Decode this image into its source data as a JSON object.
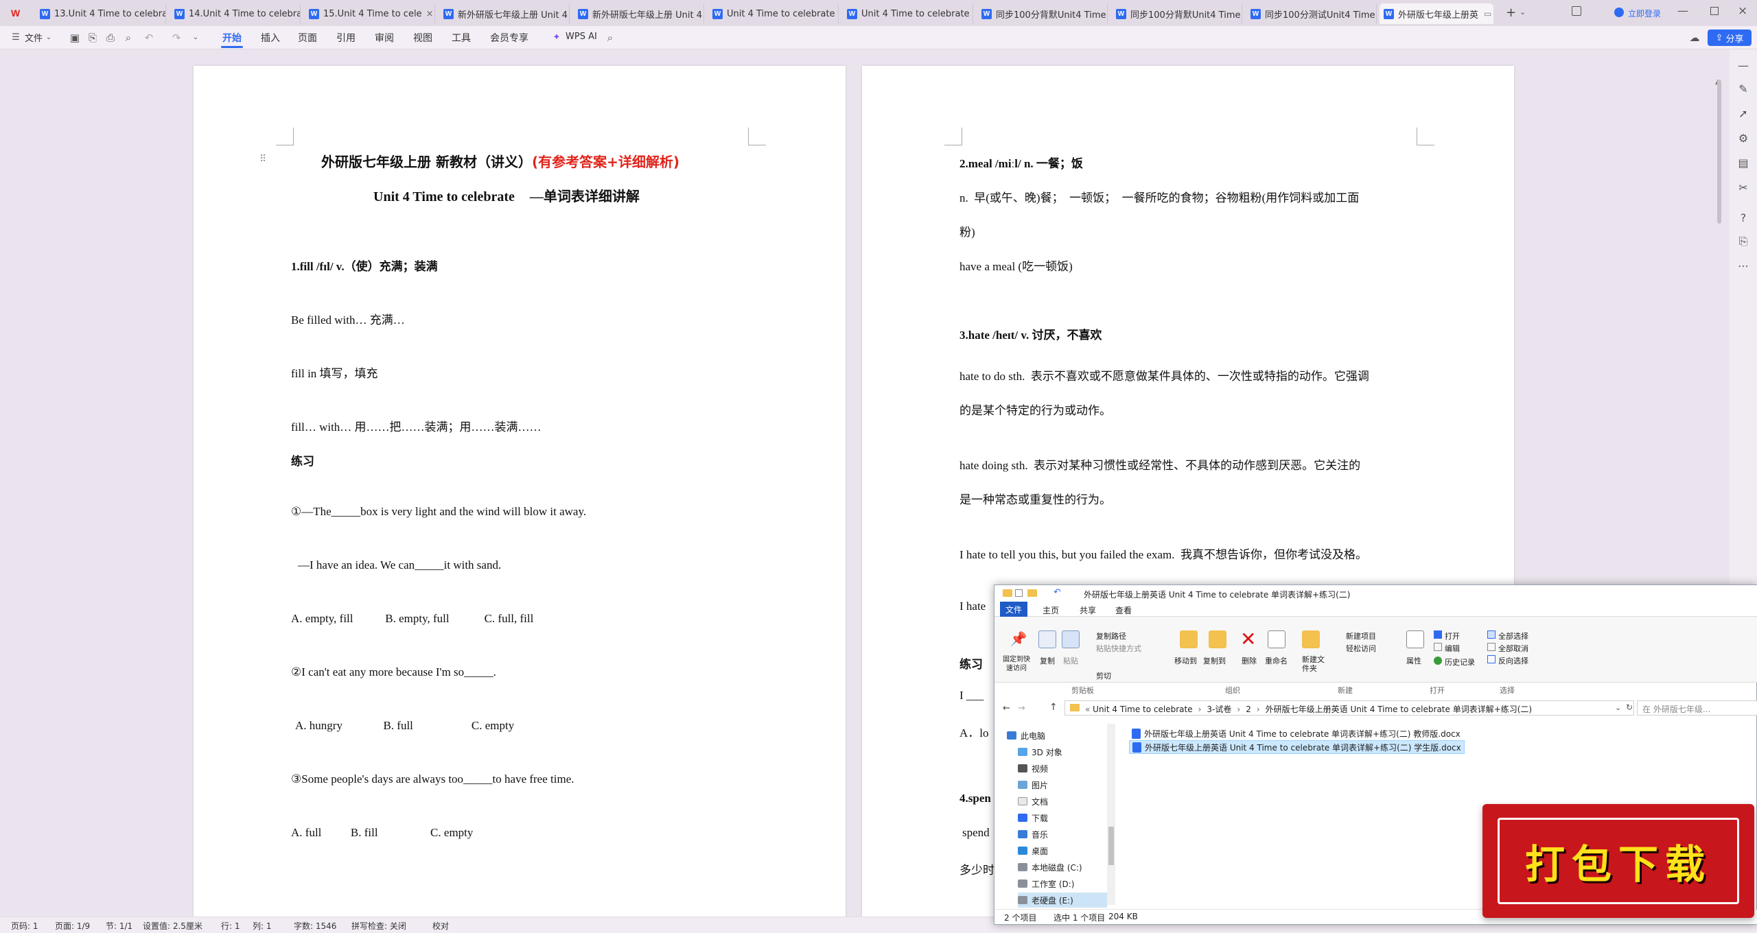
{
  "tabs": [
    {
      "label": "13.Unit 4 Time to celebrat"
    },
    {
      "label": "14.Unit 4 Time to celebrat"
    },
    {
      "label": "15.Unit 4 Time to cele"
    },
    {
      "label": "新外研版七年级上册 Unit 4"
    },
    {
      "label": "新外研版七年级上册 Unit 4"
    },
    {
      "label": "Unit 4 Time to celebrate"
    },
    {
      "label": "Unit 4 Time to celebrate"
    },
    {
      "label": "同步100分背默Unit4 Time"
    },
    {
      "label": "同步100分背默Unit4 Time"
    },
    {
      "label": "同步100分测试Unit4 Time"
    },
    {
      "label": "外研版七年级上册英"
    }
  ],
  "topright": {
    "login": "立即登录",
    "share": "分享"
  },
  "toolbar": {
    "file": "文件",
    "menus": [
      "开始",
      "插入",
      "页面",
      "引用",
      "审阅",
      "视图",
      "工具",
      "会员专享"
    ],
    "ai": "WPS AI"
  },
  "page1": {
    "title_black": "外研版七年级上册 新教材（讲义）",
    "title_red": "(有参考答案+详细解析)",
    "subtitle_a": "Unit 4 Time to celebrate",
    "subtitle_b": "—单词表详细讲解",
    "lines": [
      "1.fill /fɪl/ v.（使）充满；装满",
      "Be filled with… 充满…",
      "fill in 填写，填充",
      "fill… with… 用……把……装满；用……装满……",
      "练习",
      "①—The_____box is very light and the wind will blow it away.",
      "—I have an idea. We can_____it with sand.",
      "A. empty, fill           B. empty, full            C. full, fill",
      "②I can't eat any more because I'm so_____.",
      "A. hungry              B. full                    C. empty",
      "③Some people's days are always too_____to have free time.",
      "A. full          B. fill                  C. empty"
    ]
  },
  "page2": {
    "lines": [
      "2.meal /miːl/ n. 一餐；饭",
      "n.  早(或午、晚)餐；  一顿饭；  一餐所吃的食物；谷物粗粉(用作饲料或加工面",
      "粉)",
      "have a meal (吃一顿饭)",
      "3.hate /heɪt/ v. 讨厌，不喜欢",
      "hate to do sth.  表示不喜欢或不愿意做某件具体的、一次性或特指的动作。它强调",
      "的是某个特定的行为或动作。",
      "hate doing sth.  表示对某种习惯性或经常性、不具体的动作感到厌恶。它关注的",
      "是一种常态或重复性的行为。",
      "I hate to tell you this, but you failed the exam.  我真不想告诉你，但你考试没及格。",
      "I hate",
      "练习",
      "I ___",
      "A．lo",
      "4.spen",
      "spend",
      "多少时"
    ]
  },
  "statusbar": {
    "items": [
      "页码: 1",
      "页面: 1/9",
      "节: 1/1",
      "设置值: 2.5厘米",
      "行: 1",
      "列: 1",
      "字数: 1546",
      "拼写检查: 关闭",
      "校对"
    ]
  },
  "explorer": {
    "title": "外研版七年级上册英语  Unit 4 Time to celebrate 单词表详解+练习(二)",
    "ribbon_tabs": [
      "文件",
      "主页",
      "共享",
      "查看"
    ],
    "groups": {
      "clipboard": {
        "label": "剪贴板",
        "pin": "固定到快速访问",
        "copy": "复制",
        "paste": "粘贴",
        "copy_path": "复制路径",
        "paste_shortcut": "粘贴快捷方式",
        "cut": "剪切"
      },
      "organize": {
        "label": "组织",
        "move_to": "移动到",
        "copy_to": "复制到",
        "delete": "删除",
        "rename": "重命名"
      },
      "new": {
        "label": "新建",
        "new_item": "新建项目",
        "easy_access": "轻松访问",
        "new_folder": "新建文件夹"
      },
      "open": {
        "label": "打开",
        "properties": "属性",
        "open": "打开",
        "edit": "编辑",
        "history": "历史记录"
      },
      "select": {
        "label": "选择",
        "select_all": "全部选择",
        "select_none": "全部取消",
        "invert": "反向选择"
      }
    },
    "breadcrumb": [
      "Unit 4 Time to celebrate",
      "3-试卷",
      "2",
      "外研版七年级上册英语  Unit 4 Time to celebrate 单词表详解+练习(二)"
    ],
    "search_placeholder": "在 外研版七年级...",
    "nav": [
      "此电脑",
      "3D 对象",
      "视频",
      "图片",
      "文档",
      "下载",
      "音乐",
      "桌面",
      "本地磁盘 (C:)",
      "工作室 (D:)",
      "老硬盘 (E:)"
    ],
    "files": [
      "外研版七年级上册英语  Unit 4 Time to celebrate 单词表详解+练习(二) 教师版.docx",
      "外研版七年级上册英语  Unit 4 Time to celebrate 单词表详解+练习(二) 学生版.docx"
    ],
    "status": {
      "count": "2 个项目",
      "selected": "选中 1 个项目",
      "size": "204 KB"
    }
  },
  "banner": {
    "text": "打包下载"
  },
  "colors": {
    "accent": "#2f6bf2",
    "red_title": "#e0241b",
    "banner": "#c8161d",
    "banner_text": "#ffe21a"
  }
}
